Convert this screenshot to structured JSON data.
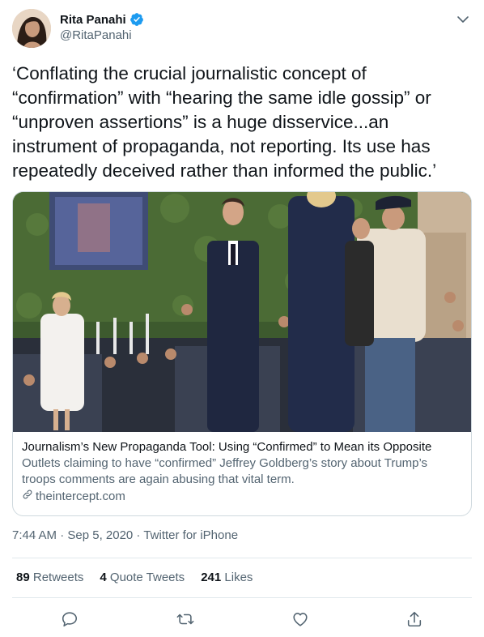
{
  "user": {
    "display_name": "Rita Panahi",
    "handle": "@RitaPanahi",
    "verified": true
  },
  "tweet": {
    "text": "‘Conflating the crucial journalistic concept of “confirmation” with “hearing the same idle gossip” or “unproven assertions” is a huge disservice...an instrument of propaganda, not reporting. Its use has repeatedly deceived rather than informed the public.’",
    "timestamp": "7:44 AM · Sep 5, 2020 · Twitter for iPhone"
  },
  "card": {
    "title": "Journalism’s New Propaganda Tool: Using “Confirmed” to Mean its Opposite",
    "description": "Outlets claiming to have “confirmed” Jeffrey Goldberg’s story about Trump’s troops comments are again abusing that vital term.",
    "domain": "theintercept.com"
  },
  "stats": {
    "retweets_count": "89",
    "retweets_label": "Retweets",
    "quotes_count": "4",
    "quotes_label": "Quote Tweets",
    "likes_count": "241",
    "likes_label": "Likes"
  },
  "colors": {
    "accent": "#1d9bf0",
    "secondary_text": "#536471",
    "border": "#cfd9de"
  },
  "icons": [
    "verified-badge-icon",
    "chevron-down-icon",
    "link-icon",
    "reply-icon",
    "retweet-icon",
    "like-icon",
    "share-icon"
  ]
}
